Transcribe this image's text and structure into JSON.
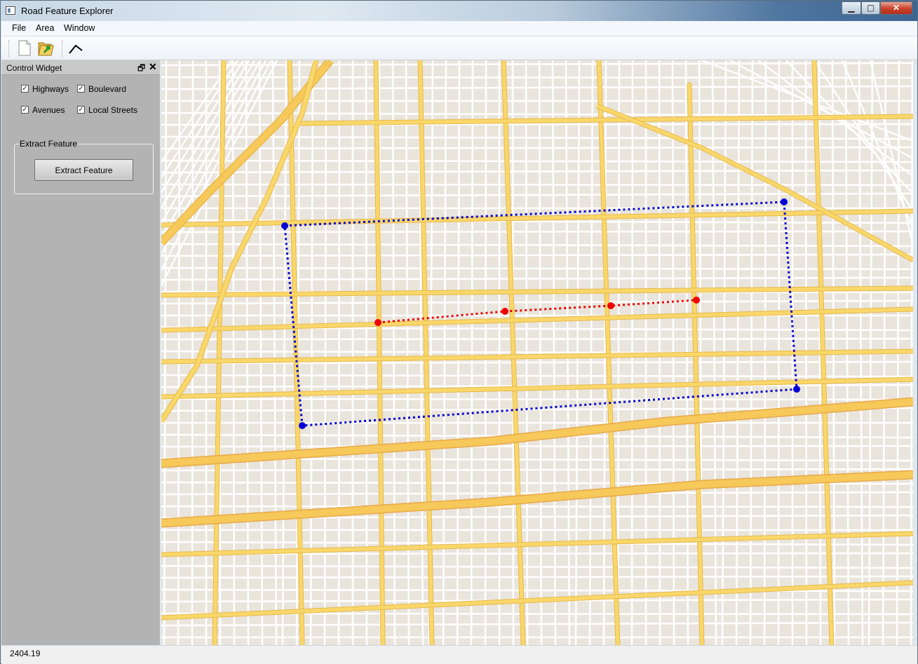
{
  "window": {
    "title": "Road Feature Explorer",
    "buttons": {
      "minimize": "▁",
      "maximize": "▢",
      "close": "✕"
    }
  },
  "menu": [
    "File",
    "Area",
    "Window"
  ],
  "toolbar": {
    "tools": [
      {
        "name": "new-file-icon",
        "interactable": true
      },
      {
        "name": "open-folder-icon",
        "interactable": true
      },
      {
        "name": "polyline-tool-icon",
        "interactable": true
      }
    ]
  },
  "dock": {
    "title": "Control Widget",
    "float_icon": "🗗",
    "close_icon": "✕",
    "filters": [
      {
        "label": "Highways",
        "checked": true
      },
      {
        "label": "Boulevard",
        "checked": true
      },
      {
        "label": "Avenues",
        "checked": true
      },
      {
        "label": "Local Streets",
        "checked": true
      }
    ],
    "group": {
      "title": "Extract Feature",
      "button_label": "Extract Feature"
    }
  },
  "map": {
    "colors": {
      "background": "#e9e4dc",
      "major_road": "#f9d76a",
      "major_road_edge": "#e8b94c",
      "highway": "#f6c95a",
      "local_street": "#ffffff",
      "selection_polygon": "#0000d6",
      "feature_line": "#ee0000"
    }
  },
  "status": {
    "value": "2404.19"
  }
}
